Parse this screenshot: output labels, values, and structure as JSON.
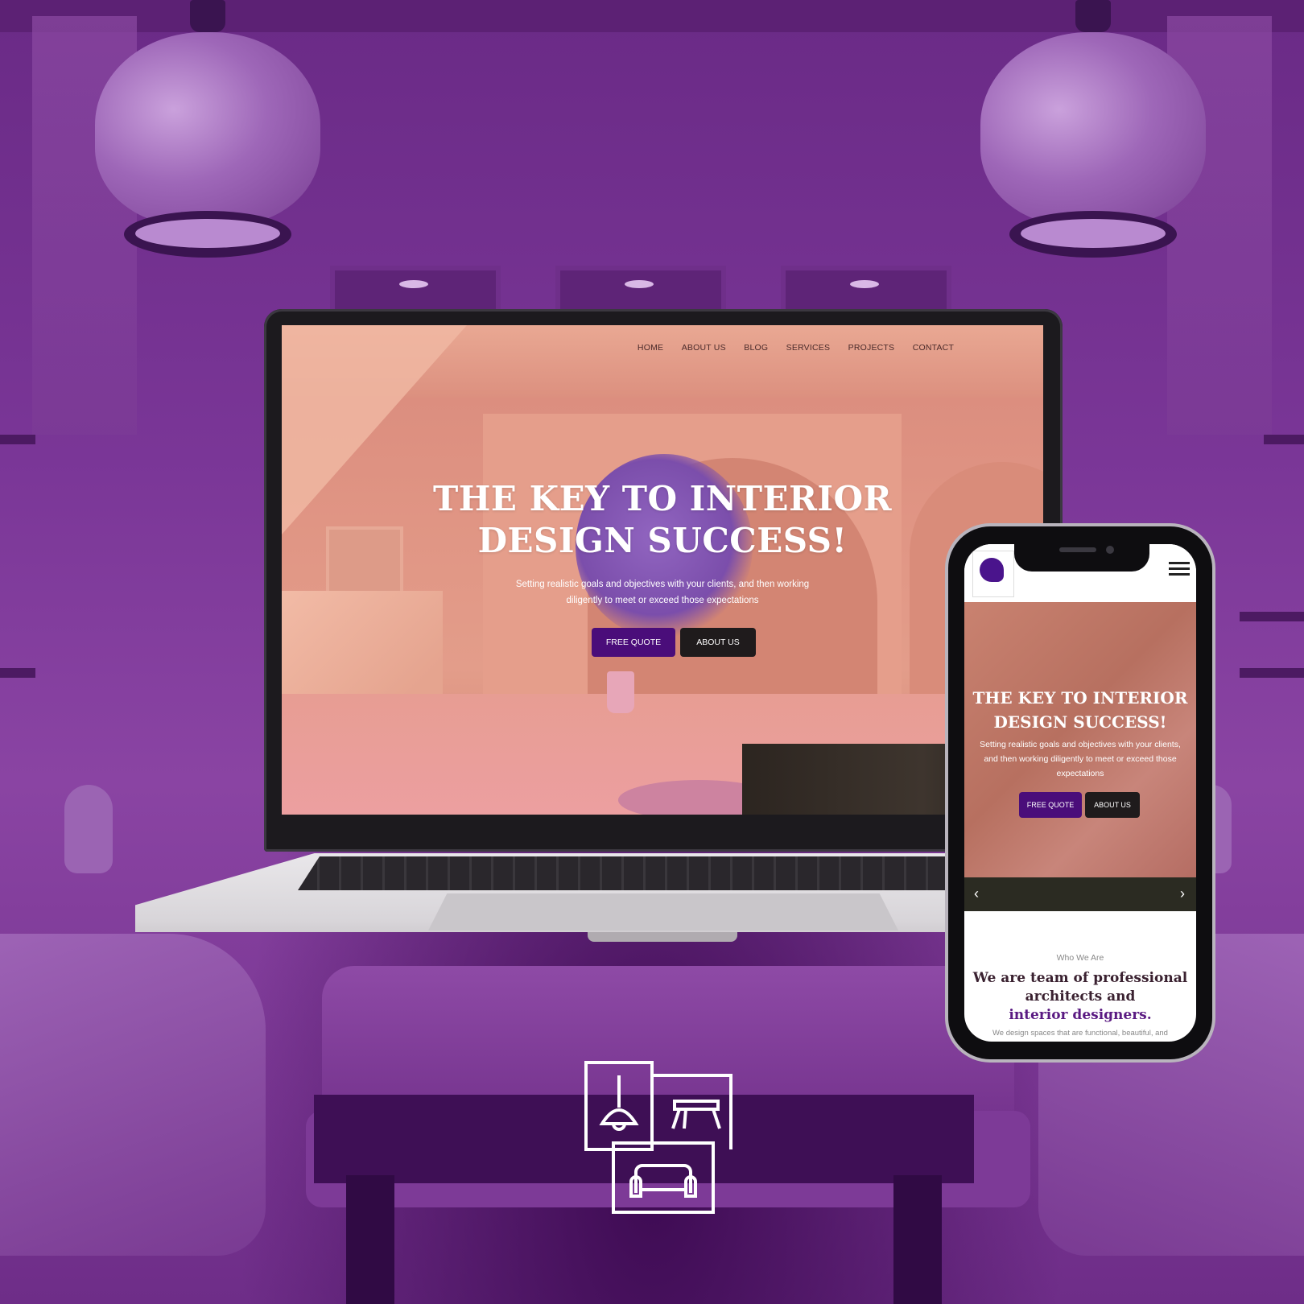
{
  "laptop": {
    "nav": [
      "HOME",
      "ABOUT US",
      "BLOG",
      "SERVICES",
      "PROJECTS",
      "CONTACT"
    ],
    "hero_title_line1": "THE KEY TO INTERIOR",
    "hero_title_line2": "DESIGN SUCCESS!",
    "hero_sub_line1": "Setting realistic goals and objectives with your clients, and then working",
    "hero_sub_line2": "diligently to meet or exceed those expectations",
    "btn_primary": "FREE QUOTE",
    "btn_secondary": "ABOUT US"
  },
  "phone": {
    "hero_title_line1": "THE KEY TO INTERIOR",
    "hero_title_line2": "DESIGN SUCCESS!",
    "hero_sub": "Setting realistic goals and objectives with your clients, and then working diligently to meet or exceed those expectations",
    "btn_primary": "FREE QUOTE",
    "btn_secondary": "ABOUT US",
    "prev_arrow": "‹",
    "next_arrow": "›",
    "who_label": "Who We Are",
    "heading_line1": "We are team of professional",
    "heading_line2": "architects and",
    "heading_accent": "interior designers.",
    "desc": "We design spaces that are functional, beautiful, and"
  },
  "colors": {
    "accent_purple": "#4a0d7a",
    "dark_button": "#1f1b1c"
  },
  "icon": "interior-design-icon"
}
